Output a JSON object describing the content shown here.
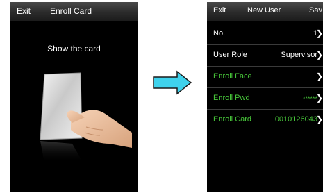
{
  "left_screen": {
    "header": {
      "exit_label": "Exit",
      "title": "Enroll Card"
    },
    "prompt": "Show the card"
  },
  "right_screen": {
    "header": {
      "exit_label": "Exit",
      "title": "New User",
      "save_label": "Sav"
    },
    "rows": [
      {
        "label": "No.",
        "value": "1",
        "color": "#ffffff"
      },
      {
        "label": "User Role",
        "value": "Supervisor",
        "color": "#ffffff"
      },
      {
        "label": "Enroll Face",
        "value": "",
        "color": "#48c83a"
      },
      {
        "label": "Enroll Pwd",
        "value": "******",
        "color": "#48c83a"
      },
      {
        "label": "Enroll Card",
        "value": "0010126043",
        "color": "#48c83a"
      }
    ]
  },
  "arrow": {
    "color": "#3fd2ec",
    "icon": "right-arrow-icon"
  }
}
